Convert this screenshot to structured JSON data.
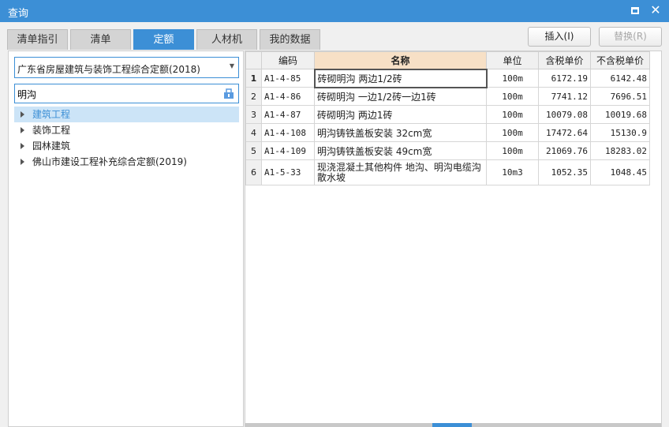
{
  "window": {
    "title": "查询"
  },
  "tabs": [
    "清单指引",
    "清单",
    "定额",
    "人材机",
    "我的数据"
  ],
  "buttons": {
    "insert": "插入(I)",
    "replace": "替换(R)"
  },
  "library_select": {
    "value": "广东省房屋建筑与装饰工程综合定额(2018)"
  },
  "search": {
    "value": "明沟"
  },
  "tree": [
    {
      "label": "建筑工程",
      "selected": true
    },
    {
      "label": "装饰工程"
    },
    {
      "label": "园林建筑"
    },
    {
      "label": "佛山市建设工程补充综合定额(2019)"
    }
  ],
  "table": {
    "headers": {
      "code": "编码",
      "name": "名称",
      "unit": "单位",
      "tax_price": "含税单价",
      "notax_price": "不含税单价"
    },
    "rows": [
      {
        "no": "1",
        "code": "A1-4-85",
        "name": "砖砌明沟 两边1/2砖",
        "unit": "100m",
        "tax_price": "6172.19",
        "notax_price": "6142.48"
      },
      {
        "no": "2",
        "code": "A1-4-86",
        "name": "砖砌明沟 一边1/2砖一边1砖",
        "unit": "100m",
        "tax_price": "7741.12",
        "notax_price": "7696.51"
      },
      {
        "no": "3",
        "code": "A1-4-87",
        "name": "砖砌明沟 两边1砖",
        "unit": "100m",
        "tax_price": "10079.08",
        "notax_price": "10019.68"
      },
      {
        "no": "4",
        "code": "A1-4-108",
        "name": "明沟铸铁盖板安装 32cm宽",
        "unit": "100m",
        "tax_price": "17472.64",
        "notax_price": "15130.9"
      },
      {
        "no": "5",
        "code": "A1-4-109",
        "name": "明沟铸铁盖板安装 49cm宽",
        "unit": "100m",
        "tax_price": "21069.76",
        "notax_price": "18283.02"
      },
      {
        "no": "6",
        "code": "A1-5-33",
        "name": "现浇混凝土其他构件 地沟、明沟电缆沟散水坡",
        "unit": "10m3",
        "tax_price": "1052.35",
        "notax_price": "1048.45"
      }
    ]
  },
  "colors": {
    "accent": "#3c8fd6",
    "name_header": "#f7e0c6",
    "selected_row": "#cce4f7"
  },
  "icons": {
    "maximize": "maximize-icon",
    "close": "close-icon",
    "search_tool": "search-tool-icon",
    "tree_arrow": "chevron-right-icon"
  }
}
